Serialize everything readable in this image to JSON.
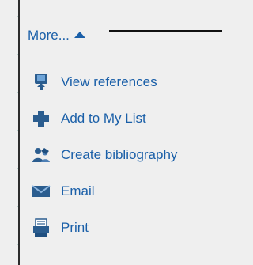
{
  "more": {
    "label": "More...",
    "arrow_icon": "triangle-up-icon"
  },
  "menu": [
    {
      "label": "View references",
      "icon": "download-icon"
    },
    {
      "label": "Add to My List",
      "icon": "plus-icon"
    },
    {
      "label": "Create bibliography",
      "icon": "people-icon"
    },
    {
      "label": "Email",
      "icon": "envelope-icon"
    },
    {
      "label": "Print",
      "icon": "printer-icon"
    }
  ],
  "colors": {
    "accent": "#1a5fa8",
    "icon": "#1f5f9a",
    "background": "#efefef"
  }
}
